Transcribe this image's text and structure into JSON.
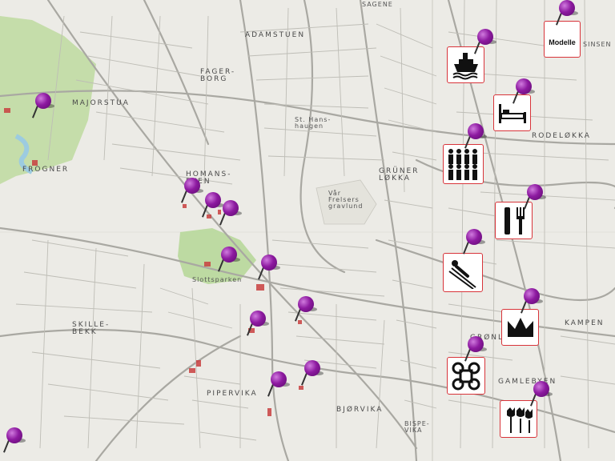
{
  "map": {
    "labels": {
      "sinsen": "SINSEN",
      "sagene": "SAGENE",
      "adamstuen": "ADAMSTUEN",
      "fagerborg": "FAGER-\nBORG",
      "majorstua": "MAJORSTUA",
      "frogner": "FROGNER",
      "homansbyen": "HOMANS-\nBYEN",
      "grunerlokka": "GRÜNER\nLØKKA",
      "rodelokka": "RODELØKKA",
      "skillebekk": "SKILLE-\nBEKK",
      "pipervika": "PIPERVIKA",
      "bjorvika": "BJØRVIKA",
      "bispevika": "BISPE-\nVIKA",
      "gronland": "GRØNLAND",
      "kampen": "KAMPEN",
      "gamlebyen": "GAMLEBYEN",
      "st_hans": "St. Hans-\nhaugen",
      "var_frelsers": "Vår\nFrelsers\ngravlund",
      "slottsparken": "Slottsparken",
      "sinsen_right": "SINSEN"
    }
  },
  "poi_icons": {
    "modelle": "Modelle",
    "ship": "ship-icon",
    "bed": "bed-icon",
    "crowd": "crowd-icon",
    "dining": "dining-icon",
    "ski": "ski-jump-icon",
    "crown": "crown-icon",
    "attraction": "place-of-interest-icon",
    "tulip": "tulip-icon"
  },
  "colors": {
    "pin": "#8d1aa0",
    "icon_border": "#d8343a",
    "park": "#b8d89a",
    "water": "#9ccbe0",
    "landmark": "#c94040"
  }
}
